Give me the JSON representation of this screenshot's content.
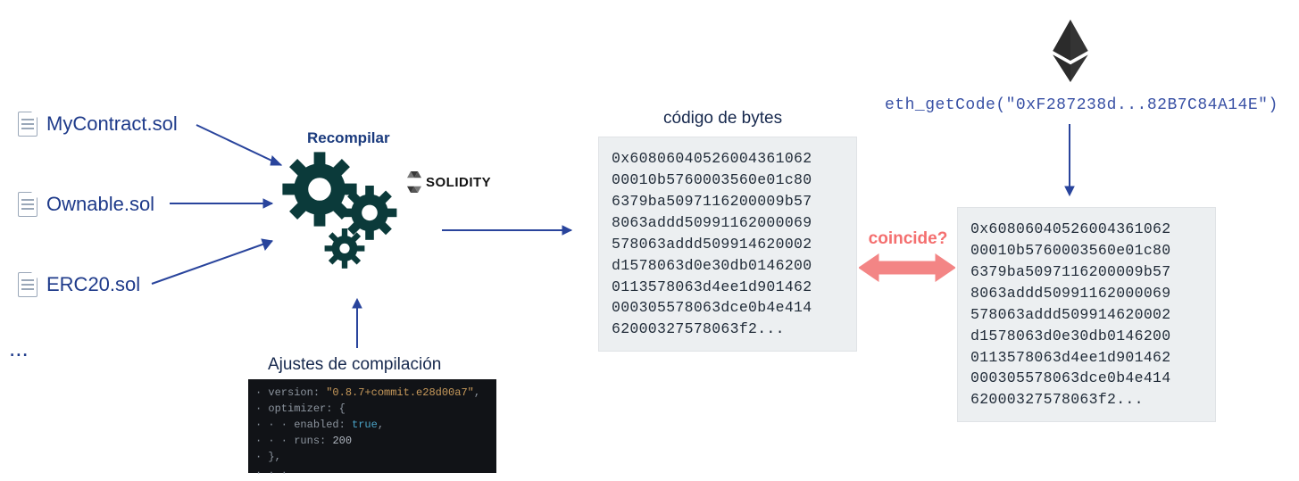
{
  "files": {
    "f1": "MyContract.sol",
    "f2": "Ownable.sol",
    "f3": "ERC20.sol",
    "ellipsis": "..."
  },
  "recompile_label": "Recompilar",
  "solidity_label": "SOLIDITY",
  "bytecode_title_left": "código de bytes",
  "bytecode_left": "0x60806040526004361062\n00010b5760003560e01c80\n6379ba5097116200009b57\n8063addd50991162000069\n578063addd509914620002\nd1578063d0e30db0146200\n0113578063d4ee1d901462\n000305578063dce0b4e414\n62000327578063f2...",
  "match_label": "coincide?",
  "eth_getcode": "eth_getCode(\"0xF287238d...82B7C84A14E\")",
  "bytecode_right": "0x60806040526004361062\n00010b5760003560e01c80\n6379ba5097116200009b57\n8063addd50991162000069\n578063addd509914620002\nd1578063d0e30db0146200\n0113578063d4ee1d901462\n000305578063dce0b4e414\n62000327578063f2...",
  "compile_title": "Ajustes de compilación",
  "compile_settings": {
    "version_key": "version:",
    "version_val": "\"0.8.7+commit.e28d00a7\"",
    "optimizer_key": "optimizer: {",
    "enabled_key": "enabled:",
    "enabled_val": "true",
    "runs_key": "runs:",
    "runs_val": "200",
    "close": "},"
  }
}
